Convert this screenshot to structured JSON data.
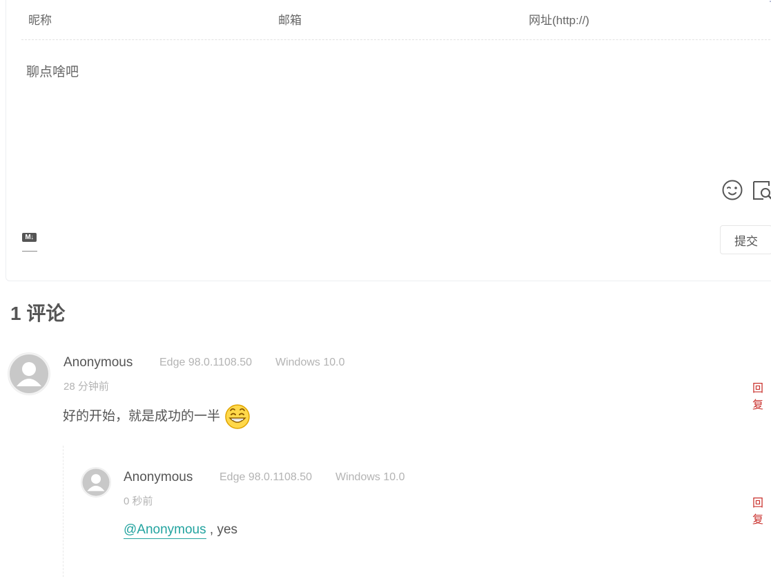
{
  "form": {
    "nick_placeholder": "昵称",
    "mail_placeholder": "邮箱",
    "link_placeholder": "网址(http://)",
    "editor_placeholder": "聊点啥吧",
    "md_label": "M↓",
    "submit_label": "提交"
  },
  "comments_header": {
    "count": "1",
    "label": "评论"
  },
  "comments": [
    {
      "nick": "Anonymous",
      "browser": "Edge 98.0.1108.50",
      "os": "Windows 10.0",
      "time": "28 分钟前",
      "reply_label": "回复",
      "content": "好的开始，就是成功的一半"
    }
  ],
  "replies": [
    {
      "nick": "Anonymous",
      "browser": "Edge 98.0.1108.50",
      "os": "Windows 10.0",
      "time": "0 秒前",
      "reply_label": "回复",
      "at": "@Anonymous",
      "content": " , yes"
    }
  ],
  "colors": {
    "reply": "#c9302c",
    "at_link": "#22a39f",
    "meta": "#b3b3b3"
  }
}
